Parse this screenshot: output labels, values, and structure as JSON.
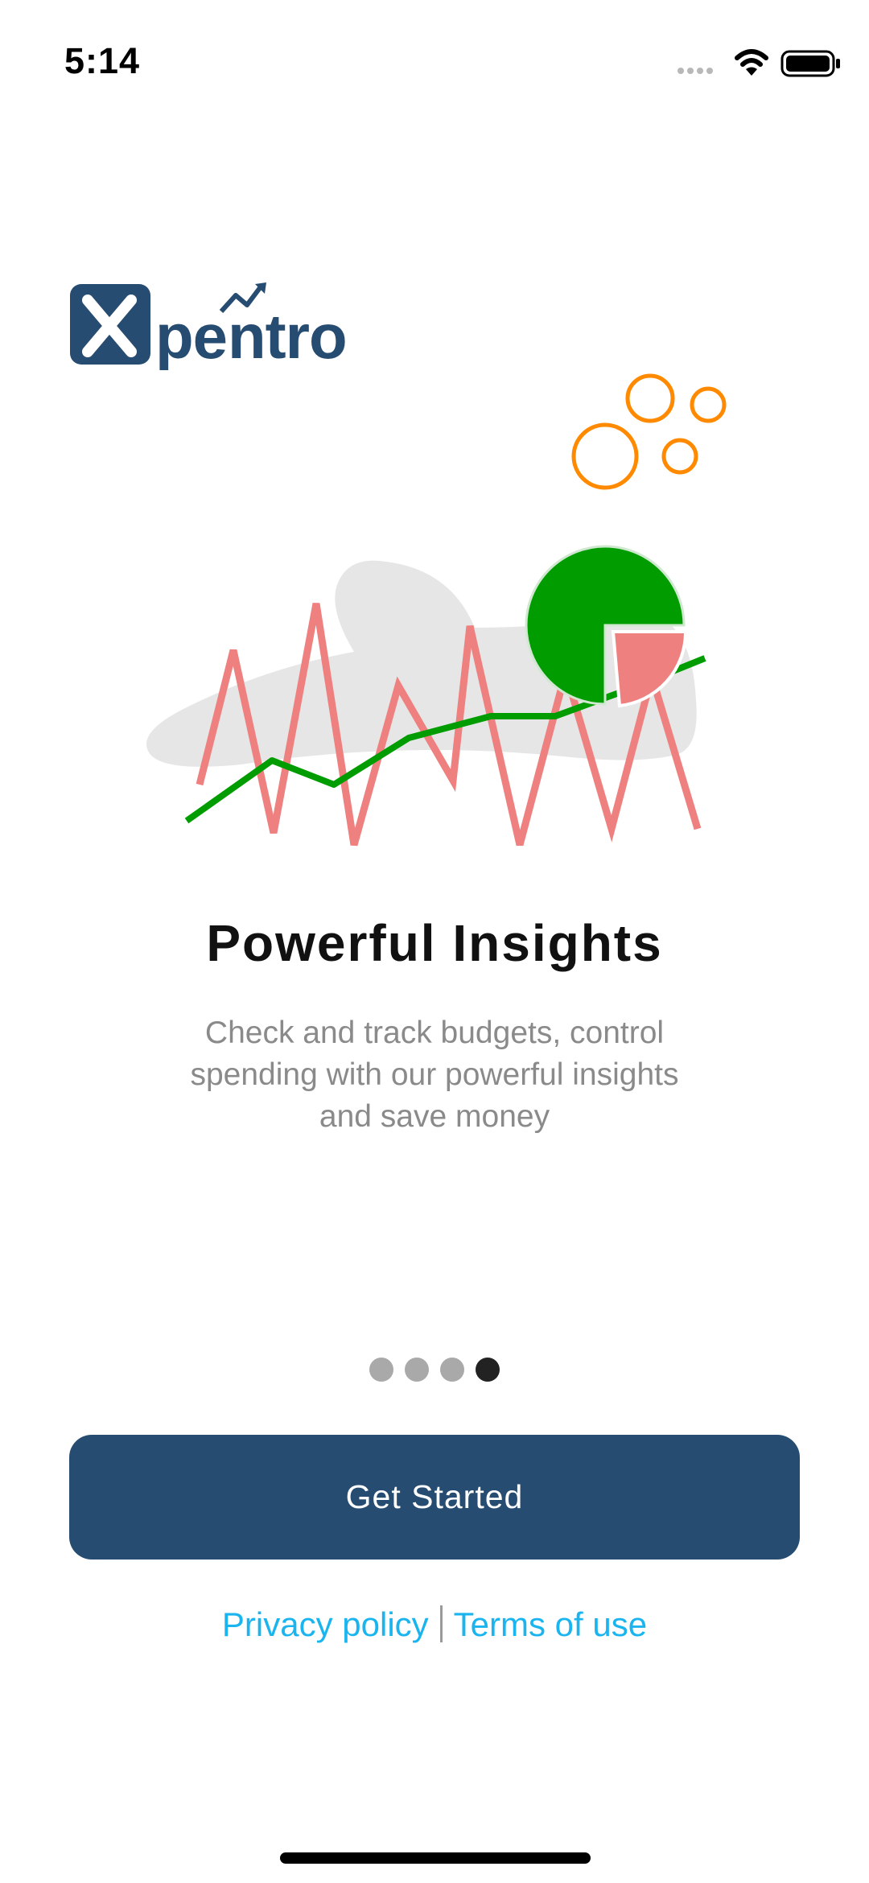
{
  "status_bar": {
    "time": "5:14"
  },
  "logo": {
    "text": "Xpentro",
    "color": "#274c71"
  },
  "onboarding": {
    "title": "Powerful Insights",
    "description": "Check and track budgets, control spending with our powerful insights and save money",
    "current_page": 4,
    "total_pages": 4
  },
  "actions": {
    "get_started_label": "Get Started",
    "privacy_label": "Privacy policy",
    "terms_label": "Terms of use"
  },
  "colors": {
    "primary": "#274c71",
    "link": "#1ab4ef",
    "chart_green": "#009c00",
    "chart_red": "#ef8080",
    "bubble_orange": "#ff8a00"
  },
  "icons": {
    "signal": "cellular-signal-icon",
    "wifi": "wifi-icon",
    "battery": "battery-icon"
  }
}
